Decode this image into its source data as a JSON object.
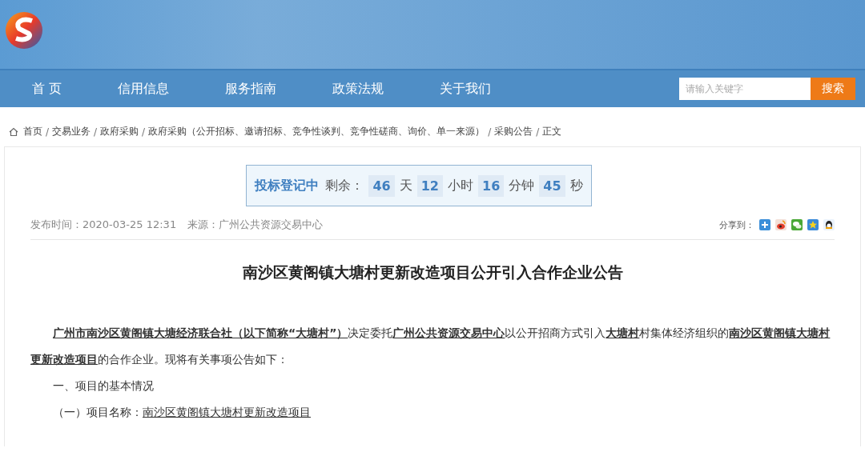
{
  "nav": {
    "items": [
      {
        "label": "首 页"
      },
      {
        "label": "信用信息"
      },
      {
        "label": "服务指南"
      },
      {
        "label": "政策法规"
      },
      {
        "label": "关于我们"
      }
    ],
    "search": {
      "placeholder": "请输入关键字",
      "button": "搜索"
    }
  },
  "breadcrumb": {
    "separator": "/",
    "items": [
      "首页",
      "交易业务",
      "政府采购",
      "政府采购（公开招标、邀请招标、竞争性谈判、竞争性磋商、询价、单一来源）",
      "采购公告",
      "正文"
    ]
  },
  "countdown": {
    "status": "投标登记中",
    "label": "剩余：",
    "parts": [
      {
        "value": "46",
        "unit": "天"
      },
      {
        "value": "12",
        "unit": "小时"
      },
      {
        "value": "16",
        "unit": "分钟"
      },
      {
        "value": "45",
        "unit": "秒"
      }
    ]
  },
  "meta": {
    "published": "发布时间：2020-03-25 12:31",
    "source": "来源：广州公共资源交易中心",
    "share_label": "分享到："
  },
  "article": {
    "title": "南沙区黄阁镇大塘村更新改造项目公开引入合作企业公告",
    "paragraphs": [
      {
        "kind": "text",
        "text": "**广州市南沙区黄阁镇大塘经济联合社（以下简称“大塘村”）**决定委托**广州公共资源交易中心**以公开招商方式引入**大塘村**村集体经济组织的**南沙区黄阁镇大塘村更新改造项目**的合作企业。现将有关事项公告如下："
      },
      {
        "kind": "text",
        "text": "一、项目的基本情况"
      },
      {
        "kind": "field",
        "label": "（一）项目名称：",
        "value": "南沙区黄阁镇大塘村更新改造项目"
      }
    ]
  }
}
